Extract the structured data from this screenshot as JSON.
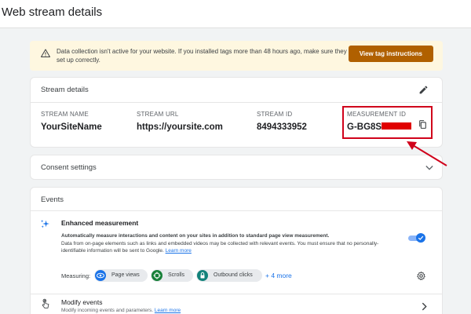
{
  "page": {
    "title": "Web stream details"
  },
  "banner": {
    "text": "Data collection isn't active for your website. If you installed tags more than 48 hours ago, make sure they are set up correctly.",
    "button_label": "View tag instructions"
  },
  "stream_details": {
    "title": "Stream details",
    "fields": [
      {
        "label": "STREAM NAME",
        "value": "YourSiteName"
      },
      {
        "label": "STREAM URL",
        "value": "https://yoursite.com"
      },
      {
        "label": "STREAM ID",
        "value": "8494333952"
      },
      {
        "label": "MEASUREMENT ID",
        "value": "G-BG8S1"
      }
    ]
  },
  "consent": {
    "title": "Consent settings"
  },
  "events": {
    "title": "Events",
    "enhanced": {
      "title": "Enhanced measurement",
      "desc_bold": "Automatically measure interactions and content on your sites in addition to standard page view measurement.",
      "desc": "Data from on-page elements such as links and embedded videos may be collected with relevant events. You must ensure that no personally-identifiable information will be sent to Google.",
      "learn_more": "Learn more",
      "enabled": true
    },
    "measuring_label": "Measuring:",
    "chips": [
      {
        "label": "Page views",
        "icon": "eye-icon"
      },
      {
        "label": "Scrolls",
        "icon": "crosshair-icon"
      },
      {
        "label": "Outbound clicks",
        "icon": "lock-icon"
      }
    ],
    "more_link": "+ 4 more",
    "modify": {
      "title": "Modify events",
      "desc": "Modify incoming events and parameters.",
      "learn_more": "Learn more"
    }
  },
  "colors": {
    "accent": "#1a73e8",
    "banner_bg": "#fef7e0",
    "banner_button": "#b06000",
    "annotation": "#d0021b"
  }
}
